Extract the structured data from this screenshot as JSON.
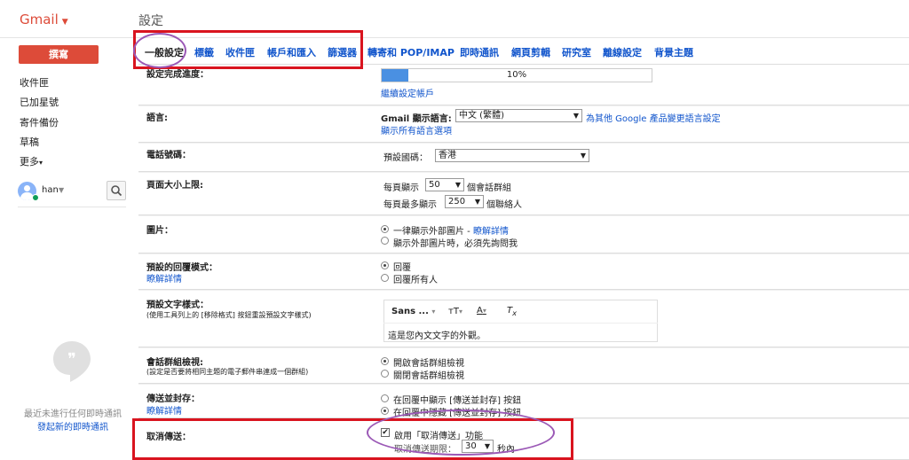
{
  "brand": "Gmail",
  "compose_label": "撰寫",
  "nav": [
    "收件匣",
    "已加星號",
    "寄件備份",
    "草稿",
    "更多"
  ],
  "user": {
    "name": "han"
  },
  "chat": {
    "empty": "最近未進行任何即時通訊",
    "start": "發起新的即時通訊"
  },
  "settings_title": "設定",
  "tabs": [
    "一般設定",
    "標籤",
    "收件匣",
    "帳戶和匯入",
    "篩選器",
    "轉寄和 POP/IMAP",
    "即時通訊",
    "網頁剪輯",
    "研究室",
    "離線設定",
    "背景主題"
  ],
  "rows": {
    "progress": {
      "label": "設定完成進度：",
      "percent_text": "10%",
      "percent": 10,
      "link": "繼續設定帳戶"
    },
    "language": {
      "label": "語言:",
      "prefix": "Gmail 顯示語言:",
      "value": "中文 (繁體)",
      "link_change": "為其他 Google 產品變更語言設定",
      "link_all": "顯示所有語言選項"
    },
    "phone": {
      "label": "電話號碼：",
      "prefix": "預設國碼：",
      "value": "香港"
    },
    "page_size": {
      "label": "頁面大小上限:",
      "l1_pre": "每頁顯示",
      "l1_val": "50",
      "l1_post": "個會話群組",
      "l2_pre": "每頁最多顯示",
      "l2_val": "250",
      "l2_post": "個聯絡人"
    },
    "images": {
      "label": "圖片：",
      "opt1": "一律顯示外部圖片",
      "opt1_link": "瞭解詳情",
      "opt2": "顯示外部圖片時，必須先詢問我"
    },
    "reply": {
      "label": "預設的回覆模式：",
      "link": "瞭解詳情",
      "opt1": "回覆",
      "opt2": "回覆所有人"
    },
    "text_style": {
      "label": "預設文字樣式：",
      "sub": "(使用工具列上的 [移除格式] 按鈕重設預設文字樣式)",
      "font": "Sans ...",
      "sample": "這是您內文文字的外觀。"
    },
    "conversation": {
      "label": "會話群組檢視:",
      "sub": "(設定是否要將相同主題的電子郵件串連成一個群組)",
      "opt1": "開啟會話群組檢視",
      "opt2": "關閉會話群組檢視"
    },
    "send_archive": {
      "label": "傳送並封存：",
      "link": "瞭解詳情",
      "opt1": "在回覆中顯示 [傳送並封存] 按鈕",
      "opt2": "在回覆中隱藏 [傳送並封存] 按鈕"
    },
    "undo_send": {
      "label": "取消傳送：",
      "check": "啟用「取消傳送」功能",
      "period_pre": "取消傳送期限：",
      "period_val": "30",
      "period_post": "秒內"
    }
  }
}
